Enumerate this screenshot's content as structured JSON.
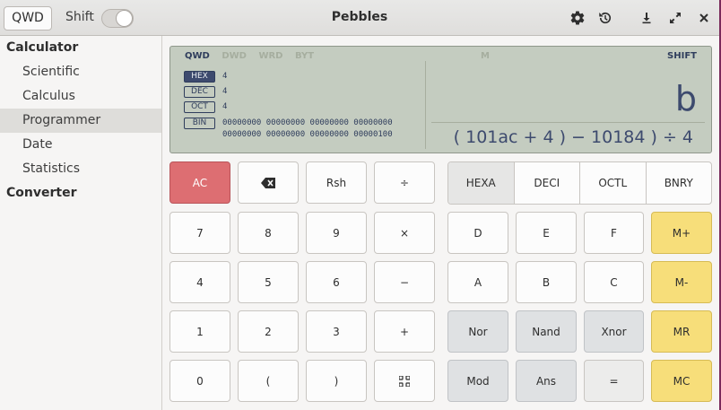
{
  "header": {
    "qwd_button": "QWD",
    "shift_label": "Shift",
    "title": "Pebbles"
  },
  "sidebar": {
    "groups": [
      {
        "label": "Calculator",
        "items": [
          "Scientific",
          "Calculus",
          "Programmer",
          "Date",
          "Statistics"
        ]
      },
      {
        "label": "Converter",
        "items": []
      }
    ],
    "active_item": "Programmer"
  },
  "display": {
    "word_sizes": [
      "QWD",
      "DWD",
      "WRD",
      "BYT"
    ],
    "active_word_size": "QWD",
    "memory_indicator": "M",
    "shift_indicator": "SHIFT",
    "bases": [
      {
        "tag": "HEX",
        "value": "4",
        "active": true
      },
      {
        "tag": "DEC",
        "value": "4",
        "active": false
      },
      {
        "tag": "OCT",
        "value": "4",
        "active": false
      },
      {
        "tag": "BIN",
        "value": "00000000 00000000 00000000 00000000\n00000000 00000000 00000000 00000100",
        "active": false
      }
    ],
    "result": "b",
    "expression": "( 101ac + 4 ) − 10184 ) ÷ 4"
  },
  "keypad": {
    "left": [
      [
        "AC",
        "⌫",
        "Rsh",
        "÷"
      ],
      [
        "7",
        "8",
        "9",
        "×"
      ],
      [
        "4",
        "5",
        "6",
        "−"
      ],
      [
        "1",
        "2",
        "3",
        "+"
      ],
      [
        "0",
        "(",
        ")",
        "⁘"
      ]
    ],
    "base_buttons": [
      "HEXA",
      "DECI",
      "OCTL",
      "BNRY"
    ],
    "selected_base": "HEXA",
    "right": [
      [
        "D",
        "E",
        "F",
        "M+"
      ],
      [
        "A",
        "B",
        "C",
        "M-"
      ],
      [
        "Nor",
        "Nand",
        "Xnor",
        "MR"
      ],
      [
        "Mod",
        "Ans",
        "=",
        "MC"
      ]
    ]
  },
  "colors": {
    "display_bg": "#c4ccc0",
    "display_text": "#3d4a6e",
    "clear_key": "#dd6e72",
    "memory_key": "#f7de7a"
  }
}
